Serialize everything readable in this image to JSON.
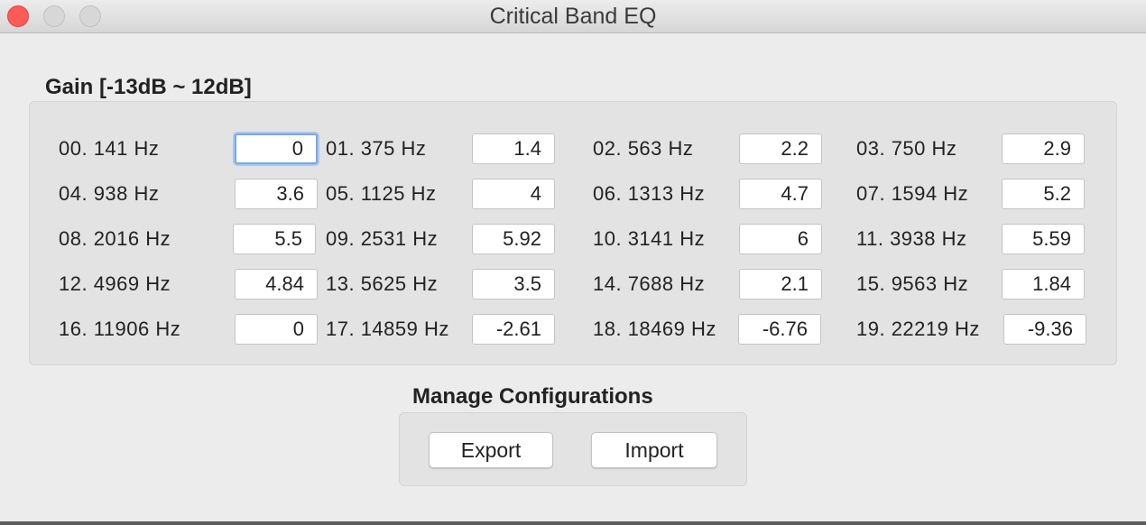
{
  "window": {
    "title": "Critical Band EQ"
  },
  "gain": {
    "title": "Gain [-13dB ~ 12dB]",
    "bands": [
      {
        "label": "00. 141 Hz",
        "value": "0"
      },
      {
        "label": "01. 375 Hz",
        "value": "1.4"
      },
      {
        "label": "02. 563 Hz",
        "value": "2.2"
      },
      {
        "label": "03. 750 Hz",
        "value": "2.9"
      },
      {
        "label": "04. 938 Hz",
        "value": "3.6"
      },
      {
        "label": "05. 1125 Hz",
        "value": "4"
      },
      {
        "label": "06. 1313 Hz",
        "value": "4.7"
      },
      {
        "label": "07. 1594 Hz",
        "value": "5.2"
      },
      {
        "label": "08. 2016 Hz",
        "value": "5.5"
      },
      {
        "label": "09. 2531 Hz",
        "value": "5.92"
      },
      {
        "label": "10. 3141 Hz",
        "value": "6"
      },
      {
        "label": "11. 3938 Hz",
        "value": "5.59"
      },
      {
        "label": "12. 4969 Hz",
        "value": "4.84"
      },
      {
        "label": "13. 5625 Hz",
        "value": "3.5"
      },
      {
        "label": "14. 7688 Hz",
        "value": "2.1"
      },
      {
        "label": "15. 9563 Hz",
        "value": "1.84"
      },
      {
        "label": "16. 11906 Hz",
        "value": "0"
      },
      {
        "label": "17. 14859 Hz",
        "value": "-2.61"
      },
      {
        "label": "18. 18469 Hz",
        "value": "-6.76"
      },
      {
        "label": "19. 22219 Hz",
        "value": "-9.36"
      }
    ]
  },
  "configurations": {
    "title": "Manage Configurations",
    "export_label": "Export",
    "import_label": "Import"
  }
}
